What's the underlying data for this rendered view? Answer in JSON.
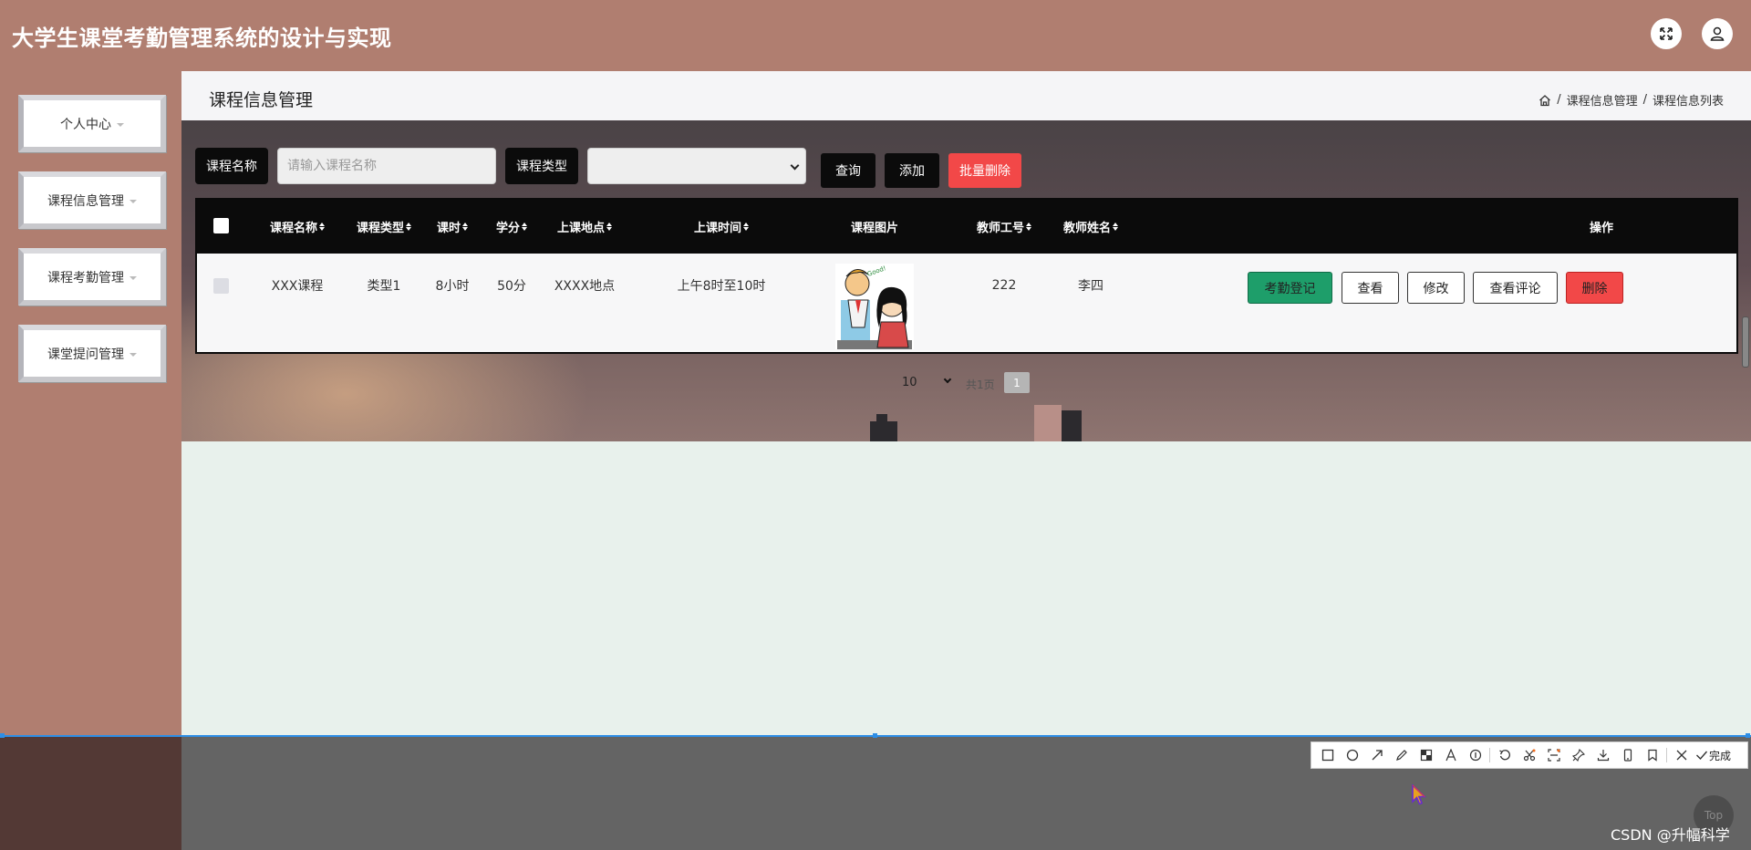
{
  "header": {
    "title": "大学生课堂考勤管理系统的设计与实现"
  },
  "sidebar": {
    "items": [
      {
        "label": "个人中心"
      },
      {
        "label": "课程信息管理"
      },
      {
        "label": "课程考勤管理"
      },
      {
        "label": "课堂提问管理"
      }
    ]
  },
  "page": {
    "title": "课程信息管理",
    "breadcrumb": [
      "课程信息管理",
      "课程信息列表"
    ],
    "breadcrumb_sep": "/"
  },
  "filters": {
    "name_label": "课程名称",
    "name_placeholder": "请输入课程名称",
    "name_value": "",
    "type_label": "课程类型",
    "type_value": "",
    "query": "查询",
    "add": "添加",
    "batch_delete": "批量删除"
  },
  "table": {
    "columns": [
      "课程名称",
      "课程类型",
      "课时",
      "学分",
      "上课地点",
      "上课时间",
      "课程图片",
      "教师工号",
      "教师姓名",
      "操作"
    ],
    "rows": [
      {
        "name": "XXX课程",
        "type": "类型1",
        "hours": "8小时",
        "credit": "50分",
        "place": "XXXX地点",
        "time": "上午8时至10时",
        "teacher_id": "222",
        "teacher_name": "李四",
        "actions": [
          "考勤登记",
          "查看",
          "修改",
          "查看评论",
          "删除"
        ]
      }
    ]
  },
  "pagination": {
    "page_size": "10",
    "total_text": "共1页",
    "current": "1"
  },
  "screenshot_tool": {
    "done_label": "完成"
  },
  "top_button": "Top",
  "watermark": "CSDN @升幅科学",
  "colors": {
    "header": "#b07e70",
    "primary": "#0b0b0b",
    "success": "#1e9e6a",
    "danger": "#f24848"
  }
}
